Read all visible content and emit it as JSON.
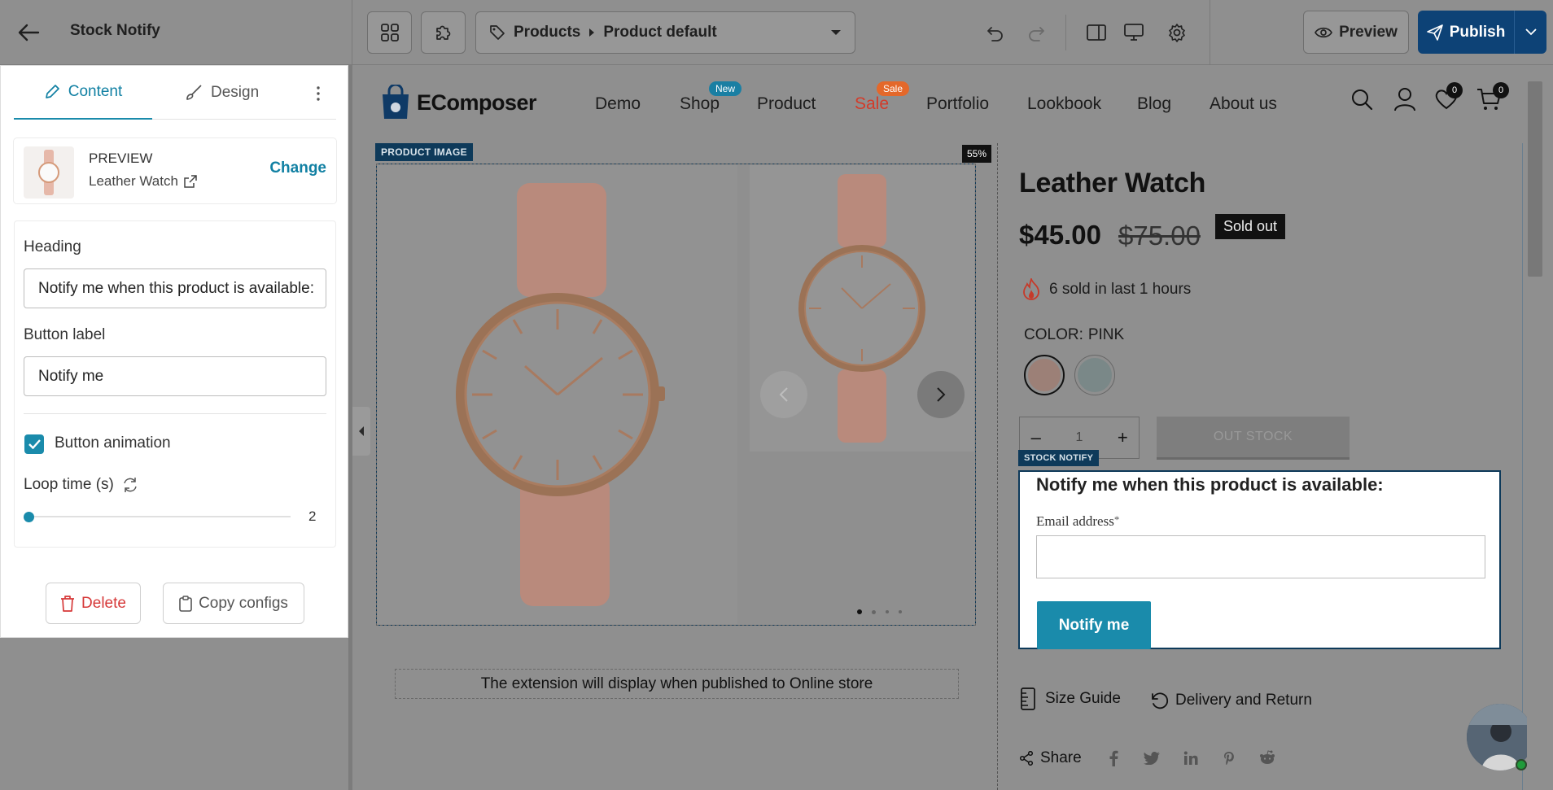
{
  "topbar": {
    "title": "Stock Notify",
    "breadcrumb": {
      "root": "Products",
      "page": "Product default"
    },
    "preview_label": "Preview",
    "publish_label": "Publish"
  },
  "panel": {
    "tabs": [
      {
        "label": "Content"
      },
      {
        "label": "Design"
      }
    ],
    "preview": {
      "heading": "PREVIEW",
      "product": "Leather Watch",
      "change_label": "Change"
    },
    "heading_label": "Heading",
    "heading_value": "Notify me when this product is available:",
    "button_label_label": "Button label",
    "button_label_value": "Notify me",
    "animation_label": "Button animation",
    "animation_checked": true,
    "loop_label": "Loop time (s)",
    "loop_value": "2",
    "delete_label": "Delete",
    "copy_label": "Copy configs"
  },
  "store": {
    "brand": "EComposer",
    "nav": [
      {
        "label": "Demo"
      },
      {
        "label": "Shop",
        "badge": "New"
      },
      {
        "label": "Product"
      },
      {
        "label": "Sale",
        "badge": "Sale"
      },
      {
        "label": "Portfolio"
      },
      {
        "label": "Lookbook"
      },
      {
        "label": "Blog"
      },
      {
        "label": "About us"
      }
    ],
    "wishlist_count": "0",
    "cart_count": "0"
  },
  "product": {
    "image_tag": "PRODUCT IMAGE",
    "width_badge": "55%",
    "title": "Leather Watch",
    "price": "$45.00",
    "compare_price": "$75.00",
    "status": "Sold out",
    "sold_text": "6 sold in last 1 hours",
    "color_label": "COLOR:",
    "color_value": "PINK",
    "swatches": [
      "#d9b3a4",
      "#a4b3b3"
    ],
    "quantity": "1",
    "out_stock_label": "OUT STOCK",
    "extension_note": "The extension will display when published to Online store",
    "size_guide": "Size Guide",
    "delivery": "Delivery and Return",
    "share": "Share"
  },
  "stock_notify": {
    "tag": "STOCK NOTIFY",
    "heading": "Notify me when this product is available:",
    "email_label": "Email address",
    "required_mark": "*",
    "button_label": "Notify me"
  },
  "colors": {
    "accent": "#1a8bab",
    "publish": "#0d4276",
    "sale": "#d33b2a",
    "new_badge": "#1a7fa3",
    "sale_badge": "#e4682a"
  }
}
